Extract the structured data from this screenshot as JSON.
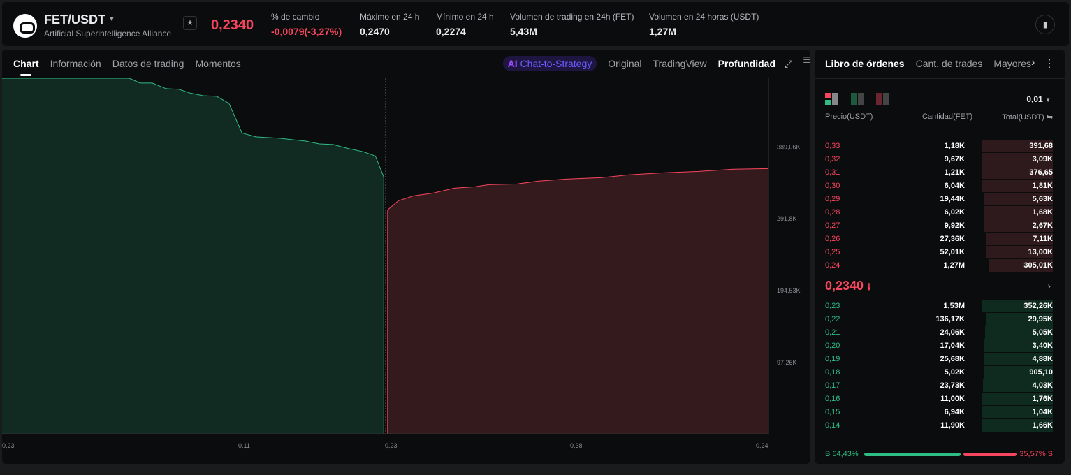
{
  "header": {
    "pair": "FET/USDT",
    "name": "Artificial Superintelligence Alliance",
    "price": "0,2340",
    "stats": [
      {
        "label": "% de cambio",
        "value": "-0,0079(-3,27%)",
        "red": true
      },
      {
        "label": "Máximo en 24 h",
        "value": "0,2470"
      },
      {
        "label": "Mínimo en 24 h",
        "value": "0,2274"
      },
      {
        "label": "Volumen de trading en 24h (FET)",
        "value": "5,43M"
      },
      {
        "label": "Volumen en 24 horas (USDT)",
        "value": "1,27M"
      }
    ]
  },
  "tabs": [
    "Chart",
    "Información",
    "Datos de trading",
    "Momentos"
  ],
  "views": {
    "ai": "AI",
    "chat": "Chat-to-Strategy",
    "original": "Original",
    "tv": "TradingView",
    "depth": "Profundidad"
  },
  "chart_data": {
    "type": "area",
    "title": "Profundidad",
    "y_ticks": [
      "97,26K",
      "194,53K",
      "291,8K",
      "389,06K"
    ],
    "y_tick_values": [
      97260,
      194530,
      291800,
      389060
    ],
    "ylim": [
      0,
      481000
    ],
    "x_ticks": [
      "0,23",
      "0,11",
      "0,23",
      "0,38",
      "0,24"
    ],
    "xlim": [
      0,
      100
    ],
    "bids": [
      [
        0,
        481000
      ],
      [
        16.6,
        481000
      ],
      [
        18,
        474500
      ],
      [
        19.6,
        474500
      ],
      [
        21.4,
        466900
      ],
      [
        23.1,
        466000
      ],
      [
        24.5,
        461000
      ],
      [
        26.2,
        457400
      ],
      [
        28,
        456500
      ],
      [
        29.6,
        447000
      ],
      [
        31.3,
        407000
      ],
      [
        33.1,
        401700
      ],
      [
        36.2,
        399800
      ],
      [
        39.6,
        396000
      ],
      [
        41.4,
        392200
      ],
      [
        43.2,
        391300
      ],
      [
        45,
        386300
      ],
      [
        47.1,
        381600
      ],
      [
        48.7,
        375900
      ],
      [
        49.8,
        347400
      ]
    ],
    "asks": [
      [
        50.3,
        302900
      ],
      [
        51.7,
        315200
      ],
      [
        53.7,
        321900
      ],
      [
        56.2,
        325600
      ],
      [
        59,
        332300
      ],
      [
        61.7,
        334200
      ],
      [
        63.5,
        337000
      ],
      [
        67.2,
        338000
      ],
      [
        69.9,
        341700
      ],
      [
        73.6,
        344600
      ],
      [
        78.1,
        346500
      ],
      [
        81.8,
        350300
      ],
      [
        86.3,
        353100
      ],
      [
        90.9,
        355000
      ],
      [
        95.4,
        357900
      ],
      [
        100,
        358800
      ]
    ],
    "colors": {
      "bid": "#2ebd85",
      "ask": "#f6465d"
    }
  },
  "book": {
    "tabs": [
      "Libro de órdenes",
      "Cant. de trades",
      "Mayores"
    ],
    "precision": "0,01",
    "headers": [
      "Precio(USDT)",
      "Cantidad(FET)",
      "Total(USDT)"
    ],
    "asks": [
      [
        "0,33",
        "1,18K",
        "391,68",
        1
      ],
      [
        "0,32",
        "9,67K",
        "3,09K",
        1
      ],
      [
        "0,31",
        "1,21K",
        "376,65",
        1
      ],
      [
        "0,30",
        "6,04K",
        "1,81K",
        0.99
      ],
      [
        "0,29",
        "19,44K",
        "5,63K",
        0.97
      ],
      [
        "0,28",
        "6,02K",
        "1,68K",
        0.97
      ],
      [
        "0,27",
        "9,92K",
        "2,67K",
        0.97
      ],
      [
        "0,26",
        "27,36K",
        "7,11K",
        0.94
      ],
      [
        "0,25",
        "52,01K",
        "13,00K",
        0.94
      ],
      [
        "0,24",
        "1,27M",
        "305,01K",
        0.9
      ]
    ],
    "mid": "0,2340",
    "bids": [
      [
        "0,23",
        "1,53M",
        "352,26K",
        1
      ],
      [
        "0,22",
        "136,17K",
        "29,95K",
        0.93
      ],
      [
        "0,21",
        "24,06K",
        "5,05K",
        0.95
      ],
      [
        "0,20",
        "17,04K",
        "3,40K",
        0.96
      ],
      [
        "0,19",
        "25,68K",
        "4,88K",
        0.97
      ],
      [
        "0,18",
        "5,02K",
        "905,10",
        0.97
      ],
      [
        "0,17",
        "23,73K",
        "4,03K",
        0.98
      ],
      [
        "0,16",
        "11,00K",
        "1,76K",
        0.99
      ],
      [
        "0,15",
        "6,94K",
        "1,04K",
        1
      ],
      [
        "0,14",
        "11,90K",
        "1,66K",
        1
      ]
    ],
    "buy_ratio": "B 64,43%",
    "sell_ratio": "35,57% S",
    "buy_pct": 64.43
  }
}
